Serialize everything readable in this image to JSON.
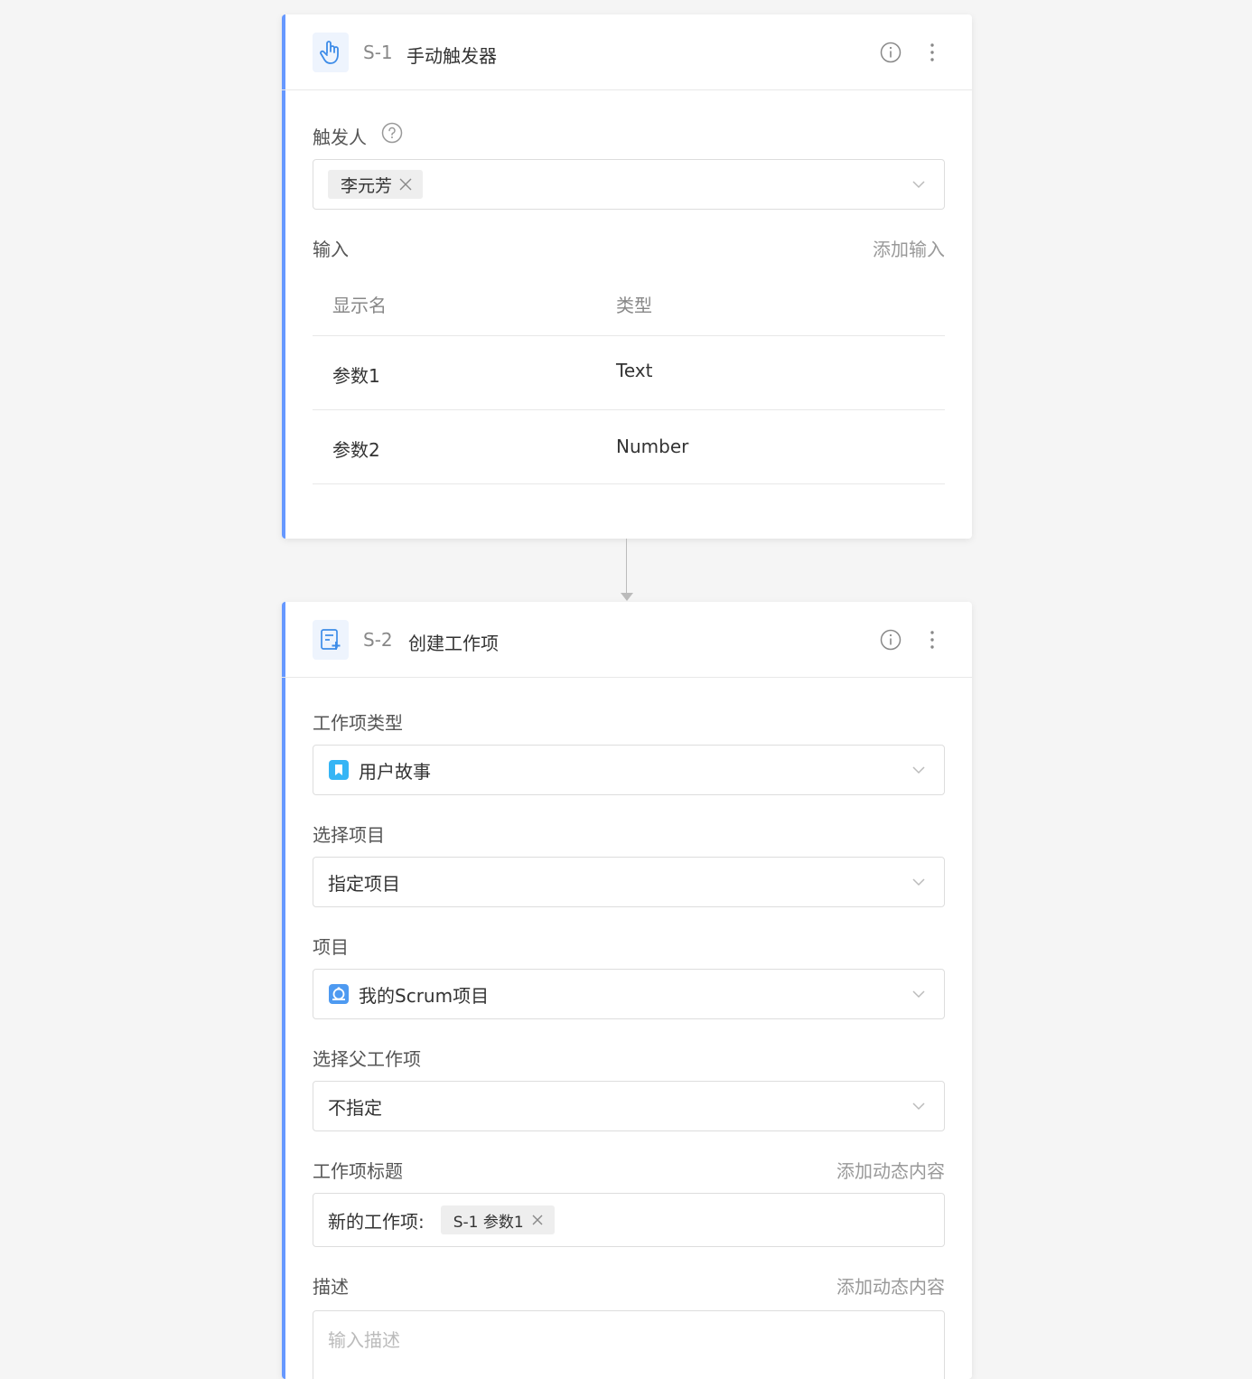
{
  "step1": {
    "id": "S-1",
    "title": "手动触发器",
    "trigger_label": "触发人",
    "trigger_user": "李元芳",
    "input_label": "输入",
    "add_input": "添加输入",
    "table": {
      "columns": [
        "显示名",
        "类型"
      ],
      "rows": [
        {
          "name": "参数1",
          "type": "Text"
        },
        {
          "name": "参数2",
          "type": "Number"
        }
      ]
    }
  },
  "step2": {
    "id": "S-2",
    "title": "创建工作项",
    "work_type_label": "工作项类型",
    "work_type_value": "用户故事",
    "select_project_label": "选择项目",
    "select_project_value": "指定项目",
    "project_label": "项目",
    "project_value": "我的Scrum项目",
    "parent_label": "选择父工作项",
    "parent_value": "不指定",
    "title_label": "工作项标题",
    "add_dynamic": "添加动态内容",
    "title_prefix": "新的工作项:",
    "title_token": "S-1 参数1",
    "desc_label": "描述",
    "desc_add_dynamic": "添加动态内容",
    "desc_placeholder": "输入描述"
  },
  "colors": {
    "accent": "#6698ff",
    "icon_blue": "#3d8ce8",
    "story_icon": "#35b5f5"
  }
}
